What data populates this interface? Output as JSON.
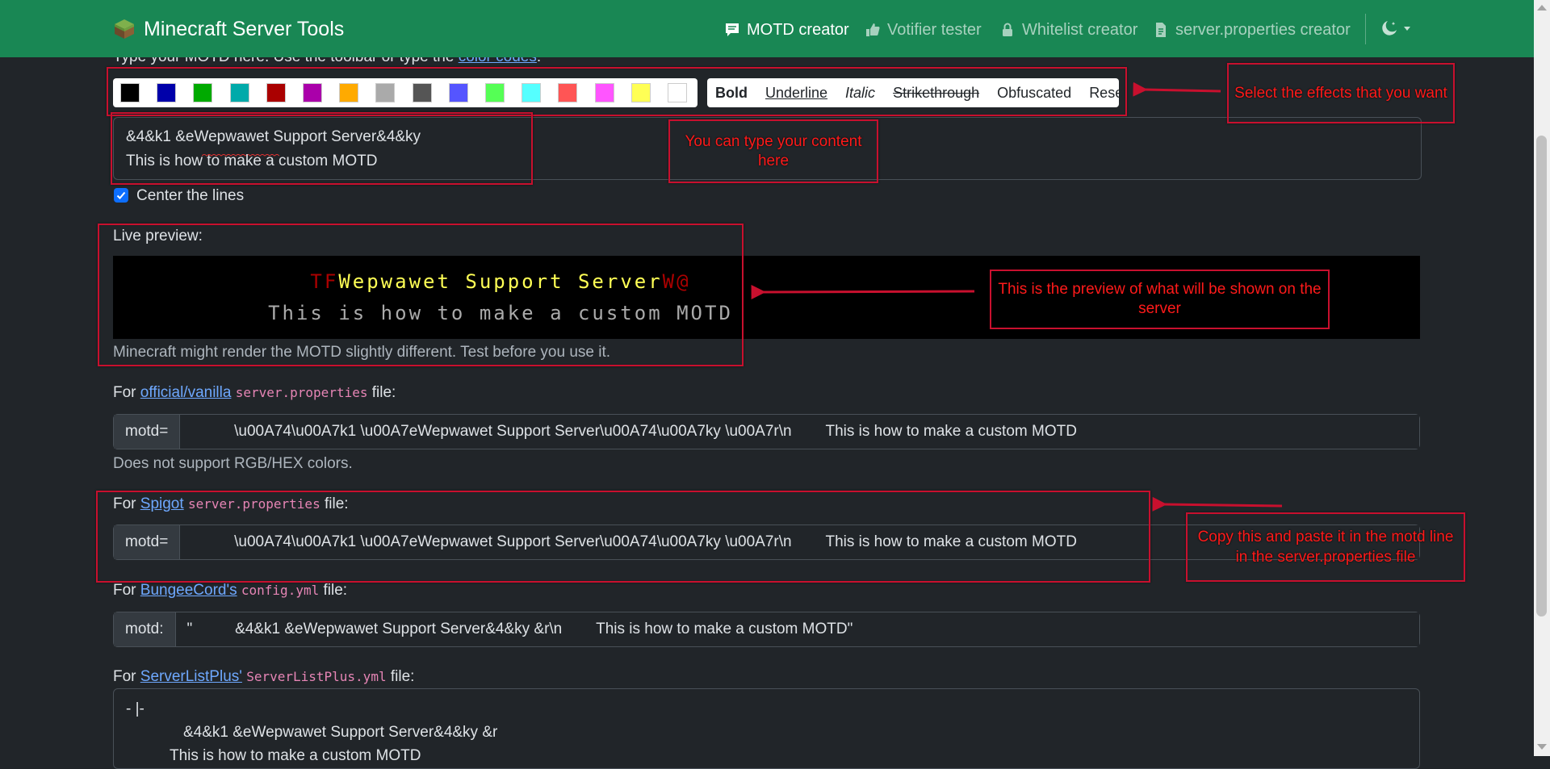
{
  "navbar": {
    "brand": "Minecraft Server Tools",
    "items": [
      {
        "label": "MOTD creator",
        "icon": "chat-square-icon",
        "active": true
      },
      {
        "label": "Votifier tester",
        "icon": "thumbs-up-icon",
        "active": false
      },
      {
        "label": "Whitelist creator",
        "icon": "lock-icon",
        "active": false
      },
      {
        "label": "server.properties creator",
        "icon": "file-icon",
        "active": false
      }
    ],
    "theme_icon": "moon-stars-icon"
  },
  "editor": {
    "intro_text": "Type your MOTD here. Use the toolbar or type the ",
    "intro_link": "color codes",
    "intro_end": ":",
    "colors": [
      "#000000",
      "#0000aa",
      "#00aa00",
      "#00aaaa",
      "#aa0000",
      "#aa00aa",
      "#ffaa00",
      "#aaaaaa",
      "#555555",
      "#5555ff",
      "#55ff55",
      "#55ffff",
      "#ff5555",
      "#ff55ff",
      "#ffff55",
      "#ffffff"
    ],
    "format_buttons": {
      "bold": "Bold",
      "underline": "Underline",
      "italic": "Italic",
      "strikethrough": "Strikethrough",
      "obfuscated": "Obfuscated",
      "reset": "Reset"
    },
    "line1": "&4&k1 &eWepwawet Support Server&4&ky",
    "line2": "This is how to make a custom MOTD",
    "center_label": "Center the lines",
    "center_checked": true
  },
  "preview": {
    "label": "Live preview:",
    "line1_prefix": "TF",
    "line1_main": "Wepwawet Support Server",
    "line1_suffix": "W@",
    "line2": "This is how to make a custom MOTD",
    "note": "Minecraft might render the MOTD slightly different. Test before you use it.",
    "colors": {
      "dark_red": "#aa0000",
      "yellow": "#ffff55",
      "gray": "#aaaaaa"
    }
  },
  "vanilla": {
    "for": "For ",
    "link": "official/vanilla",
    "file": "server.properties",
    "suffix": " file:",
    "key": "motd=",
    "value": "          \\u00A74\\u00A7k1 \\u00A7eWepwawet Support Server\\u00A74\\u00A7ky \\u00A7r\\n        This is how to make a custom MOTD",
    "note": "Does not support RGB/HEX colors."
  },
  "spigot": {
    "for": "For ",
    "link": "Spigot",
    "file": "server.properties",
    "suffix": " file:",
    "key": "motd=",
    "value": "          \\u00A74\\u00A7k1 \\u00A7eWepwawet Support Server\\u00A74\\u00A7ky \\u00A7r\\n        This is how to make a custom MOTD"
  },
  "bungee": {
    "for": "For ",
    "link": "BungeeCord's",
    "file": "config.yml",
    "suffix": " file:",
    "key": "motd:",
    "value": "\"          &4&k1 &eWepwawet Support Server&4&ky &r\\n        This is how to make a custom MOTD\""
  },
  "slp": {
    "for": "For ",
    "link": "ServerListPlus'",
    "file": "ServerListPlus.yml",
    "suffix": " file:",
    "line1": "- |-",
    "line2": "&4&k1 &eWepwawet Support Server&4&ky &r",
    "line3": "This is how to make a custom MOTD"
  },
  "annotations": {
    "effects": "Select the effects that you want",
    "content": "You can type your content here",
    "preview": "This is the preview of what will be shown on the server",
    "copy": "Copy this and paste it in the motd line in the server.properties file",
    "color": "#ff1a1a"
  }
}
